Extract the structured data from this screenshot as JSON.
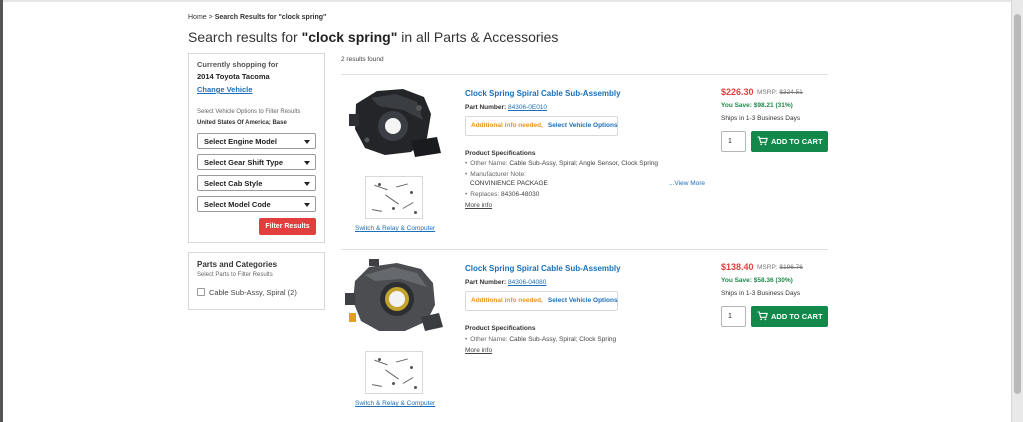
{
  "breadcrumb": {
    "home": "Home",
    "separator": ">",
    "current": "Search Results for \"clock spring\""
  },
  "header": {
    "title_prefix": "Search results for ",
    "query": "\"clock spring\"",
    "title_suffix": " in all Parts & Accessories"
  },
  "vehicle_panel": {
    "currently_label": "Currently shopping for",
    "vehicle": "2014 Toyota Tacoma",
    "change_link": "Change Vehicle",
    "options_hint": "Select Vehicle Options to Filter Results",
    "selected_options": "United States Of America; Base",
    "selects": [
      {
        "label": "Select Engine Model"
      },
      {
        "label": "Select Gear Shift Type"
      },
      {
        "label": "Select Cab Style"
      },
      {
        "label": "Select Model Code"
      }
    ],
    "filter_button": "Filter Results"
  },
  "parts_panel": {
    "title": "Parts and Categories",
    "hint": "Select Parts to Filter Results",
    "items": [
      {
        "label": "Cable Sub-Assy, Spiral (2)"
      }
    ]
  },
  "results": {
    "count_text": "2 results found",
    "products": [
      {
        "title": "Clock Spring Spiral Cable Sub-Assembly",
        "part_label": "Part Number:",
        "part_number": "84306-0E010",
        "notice_warning": "Additional info needed,",
        "notice_link": "Select Vehicle Options",
        "specs_heading": "Product Specifications",
        "other_name_label": "Other Name:",
        "other_name": "Cable Sub-Assy, Spiral; Angle Sensor, Clock Spring",
        "mfr_note_label": "Manufacturer Note:",
        "mfr_note": "CONVINIENCE PACKAGE",
        "replaces_label": "Replaces:",
        "replaces": "84306-48030",
        "view_more": "...View More",
        "more_info": "More info",
        "thumb_link": "Switch & Relay & Computer",
        "price": "$226.30",
        "msrp_label": "MSRP:",
        "msrp": "$324.51",
        "save": "You Save: $98.21 (31%)",
        "ships": "Ships in 1-3 Business Days",
        "qty": "1",
        "add_to_cart": "ADD TO CART"
      },
      {
        "title": "Clock Spring Spiral Cable Sub-Assembly",
        "part_label": "Part Number:",
        "part_number": "84306-04080",
        "notice_warning": "Additional info needed,",
        "notice_link": "Select Vehicle Options",
        "specs_heading": "Product Specifications",
        "other_name_label": "Other Name:",
        "other_name": "Cable Sub-Assy, Spiral; Clock Spring",
        "more_info": "More info",
        "thumb_link": "Switch & Relay & Computer",
        "price": "$138.40",
        "msrp_label": "MSRP:",
        "msrp": "$196.76",
        "save": "You Save: $58.36 (30%)",
        "ships": "Ships in 1-3 Business Days",
        "qty": "1",
        "add_to_cart": "ADD TO CART"
      }
    ]
  },
  "colors": {
    "link": "#1c6fb8",
    "price": "#e33e3e",
    "save": "#1e8a4a",
    "cart_button": "#12884a",
    "filter_button": "#e33e3e",
    "warning": "#e8951c"
  },
  "icons": {
    "cart": "cart-icon",
    "select_caret": "chevron-down-icon"
  }
}
